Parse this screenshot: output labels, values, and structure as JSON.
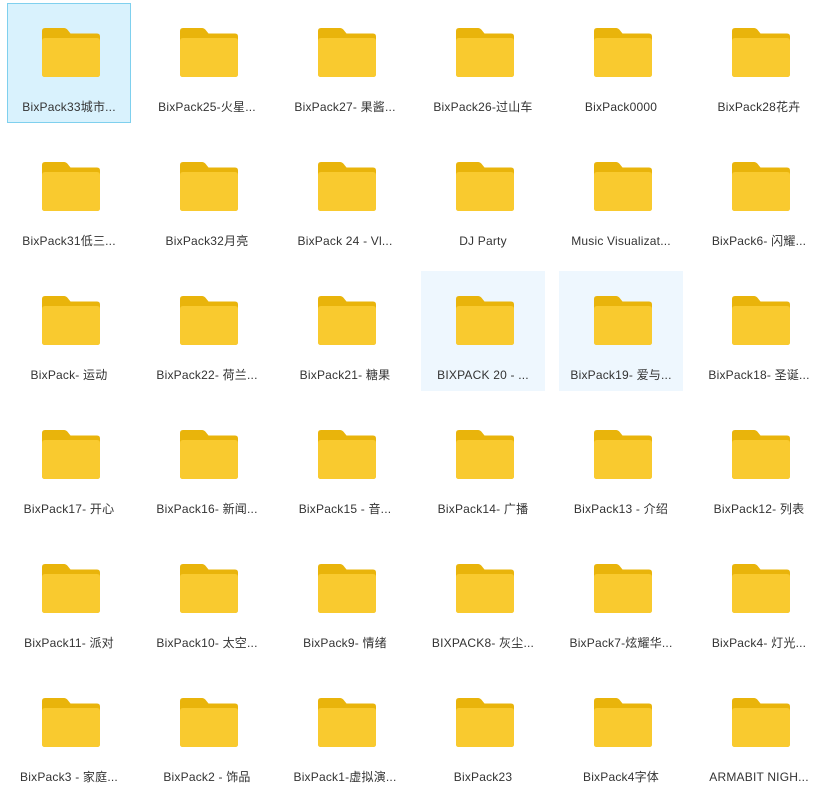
{
  "colors": {
    "folder_back": "#E9B40B",
    "folder_front": "#F9CA2F",
    "selected_bg": "#D9F2FD",
    "selected_border": "#7FD0EE",
    "hover_bg": "#EEF7FE",
    "label_text": "#333333"
  },
  "icon": "folder-icon",
  "files": [
    {
      "name": "BixPack33城市...",
      "state": "selected"
    },
    {
      "name": "BixPack25-火星...",
      "state": ""
    },
    {
      "name": "BixPack27- 果酱...",
      "state": ""
    },
    {
      "name": "BixPack26-过山车",
      "state": ""
    },
    {
      "name": "BixPack0000",
      "state": ""
    },
    {
      "name": "BixPack28花卉",
      "state": ""
    },
    {
      "name": "BixPack31低三...",
      "state": ""
    },
    {
      "name": "BixPack32月亮",
      "state": ""
    },
    {
      "name": "BixPack 24 - Vl...",
      "state": ""
    },
    {
      "name": "DJ Party",
      "state": ""
    },
    {
      "name": "Music Visualizat...",
      "state": ""
    },
    {
      "name": "BixPack6- 闪耀...",
      "state": ""
    },
    {
      "name": "BixPack- 运动",
      "state": ""
    },
    {
      "name": "BixPack22- 荷兰...",
      "state": ""
    },
    {
      "name": "BixPack21- 糖果",
      "state": ""
    },
    {
      "name": "BIXPACK 20 - ...",
      "state": "hover"
    },
    {
      "name": "BixPack19- 爱与...",
      "state": "hover"
    },
    {
      "name": "BixPack18- 圣诞...",
      "state": ""
    },
    {
      "name": "BixPack17- 开心",
      "state": ""
    },
    {
      "name": "BixPack16- 新闻...",
      "state": ""
    },
    {
      "name": "BixPack15 - 音...",
      "state": ""
    },
    {
      "name": "BixPack14- 广播",
      "state": ""
    },
    {
      "name": "BixPack13 - 介绍",
      "state": ""
    },
    {
      "name": "BixPack12- 列表",
      "state": ""
    },
    {
      "name": "BixPack11- 派对",
      "state": ""
    },
    {
      "name": "BixPack10- 太空...",
      "state": ""
    },
    {
      "name": "BixPack9- 情绪",
      "state": ""
    },
    {
      "name": "BIXPACK8- 灰尘...",
      "state": ""
    },
    {
      "name": "BixPack7-炫耀华...",
      "state": ""
    },
    {
      "name": "BixPack4- 灯光...",
      "state": ""
    },
    {
      "name": "BixPack3 - 家庭...",
      "state": ""
    },
    {
      "name": "BixPack2 - 饰品",
      "state": ""
    },
    {
      "name": "BixPack1-虚拟演...",
      "state": ""
    },
    {
      "name": "BixPack23",
      "state": ""
    },
    {
      "name": "BixPack4字体",
      "state": ""
    },
    {
      "name": "ARMABIT NIGH...",
      "state": ""
    }
  ]
}
